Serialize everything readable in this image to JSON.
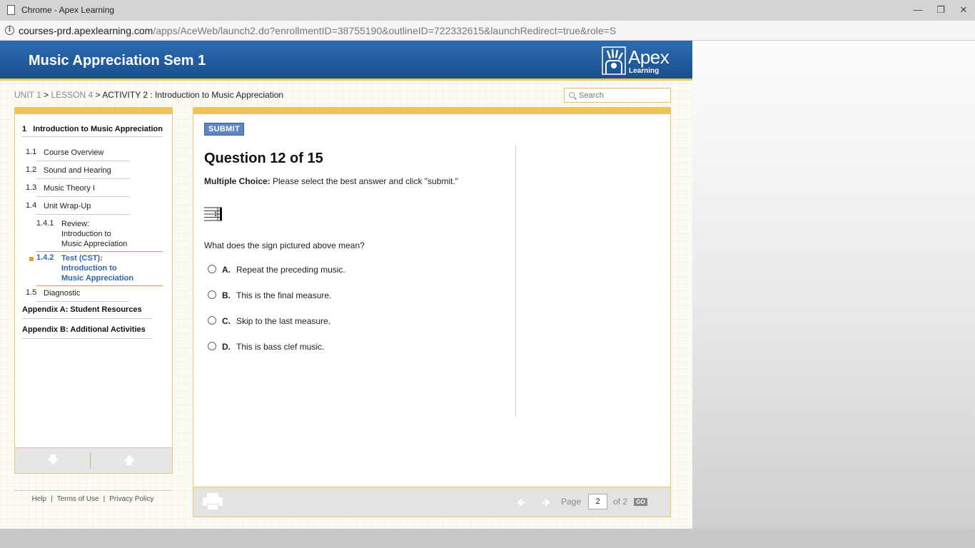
{
  "browser": {
    "window_title": "Chrome - Apex Learning",
    "url_host": "courses-prd.apexlearning.com",
    "url_path": "/apps/AceWeb/launch2.do?enrollmentID=38755190&outlineID=722332615&launchRedirect=true&role=S"
  },
  "header": {
    "course_title": "Music Appreciation Sem 1",
    "logo_text": "Apex",
    "logo_subtext": "Learning"
  },
  "breadcrumb": {
    "unit": "UNIT 1",
    "sep1": " > ",
    "lesson": "LESSON 4",
    "sep2": " > ",
    "activity": "ACTIVITY 2 : Introduction to Music Appreciation"
  },
  "search": {
    "placeholder": "Search"
  },
  "sidebar": {
    "heading_num": "1",
    "heading_label": "Introduction to Music Appreciation",
    "items": [
      {
        "num": "1.1",
        "label": "Course Overview"
      },
      {
        "num": "1.2",
        "label": "Sound and Hearing"
      },
      {
        "num": "1.3",
        "label": "Music Theory I"
      },
      {
        "num": "1.4",
        "label": "Unit Wrap-Up"
      },
      {
        "num": "1.4.1",
        "label_line1": "Review:",
        "label_line2": "Introduction to",
        "label_line3": "Music Appreciation"
      },
      {
        "num": "1.4.2",
        "label_line1": "Test (CST):",
        "label_line2": "Introduction to",
        "label_line3": "Music Appreciation"
      },
      {
        "num": "1.5",
        "label": "Diagnostic"
      }
    ],
    "appendix_a": "Appendix A: Student Resources",
    "appendix_b": "Appendix B: Additional Activities"
  },
  "footer": {
    "help": "Help",
    "sep": "|",
    "terms": "Terms of Use",
    "privacy": "Privacy Policy"
  },
  "question": {
    "submit_label": "SUBMIT",
    "title": "Question 12 of 15",
    "type_label": "Multiple Choice:",
    "instruction": " Please select the best answer and click \"submit.\"",
    "prompt": "What does the sign pictured above mean?",
    "choices": [
      {
        "letter": "A.",
        "text": "Repeat the preceding music."
      },
      {
        "letter": "B.",
        "text": "This is the final measure."
      },
      {
        "letter": "C.",
        "text": "Skip to the last measure."
      },
      {
        "letter": "D.",
        "text": "This is bass clef music."
      }
    ]
  },
  "pager": {
    "page_label": "Page",
    "page_value": "2",
    "of_label": "of 2",
    "go_label": "GO"
  },
  "colors": {
    "banner_blue": "#1a4f8e",
    "accent_gold": "#f0c45a",
    "active_link": "#2a68ad",
    "submit_blue": "#5d86bf"
  }
}
